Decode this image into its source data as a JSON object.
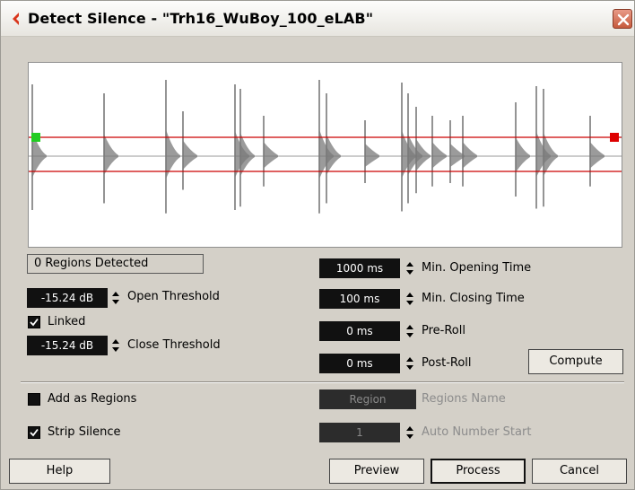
{
  "window": {
    "title": "Detect Silence - \"Trh16_WuBoy_100_eLAB\""
  },
  "waveform": {
    "open_marker_color": "#22cc22",
    "close_marker_color": "#dd0000",
    "threshold_line_color": "#cc0000",
    "wave_color": "#7a7a7a"
  },
  "status": {
    "regions_detected": "0  Regions Detected"
  },
  "thresholds": {
    "open_value": "-15.24 dB",
    "open_label": "Open Threshold",
    "linked_label": "Linked",
    "linked_checked": true,
    "close_value": "-15.24 dB",
    "close_label": "Close Threshold"
  },
  "timing": {
    "min_opening_value": "1000 ms",
    "min_opening_label": "Min. Opening Time",
    "min_closing_value": "100 ms",
    "min_closing_label": "Min. Closing Time",
    "pre_roll_value": "0 ms",
    "pre_roll_label": "Pre-Roll",
    "post_roll_value": "0 ms",
    "post_roll_label": "Post-Roll"
  },
  "options": {
    "add_as_regions_label": "Add as Regions",
    "add_as_regions_checked": false,
    "strip_silence_label": "Strip Silence",
    "strip_silence_checked": true,
    "region_name_value": "Region",
    "region_name_label": "Regions Name",
    "auto_number_value": "1",
    "auto_number_label": "Auto Number Start"
  },
  "buttons": {
    "compute": "Compute",
    "help": "Help",
    "preview": "Preview",
    "process": "Process",
    "cancel": "Cancel"
  }
}
